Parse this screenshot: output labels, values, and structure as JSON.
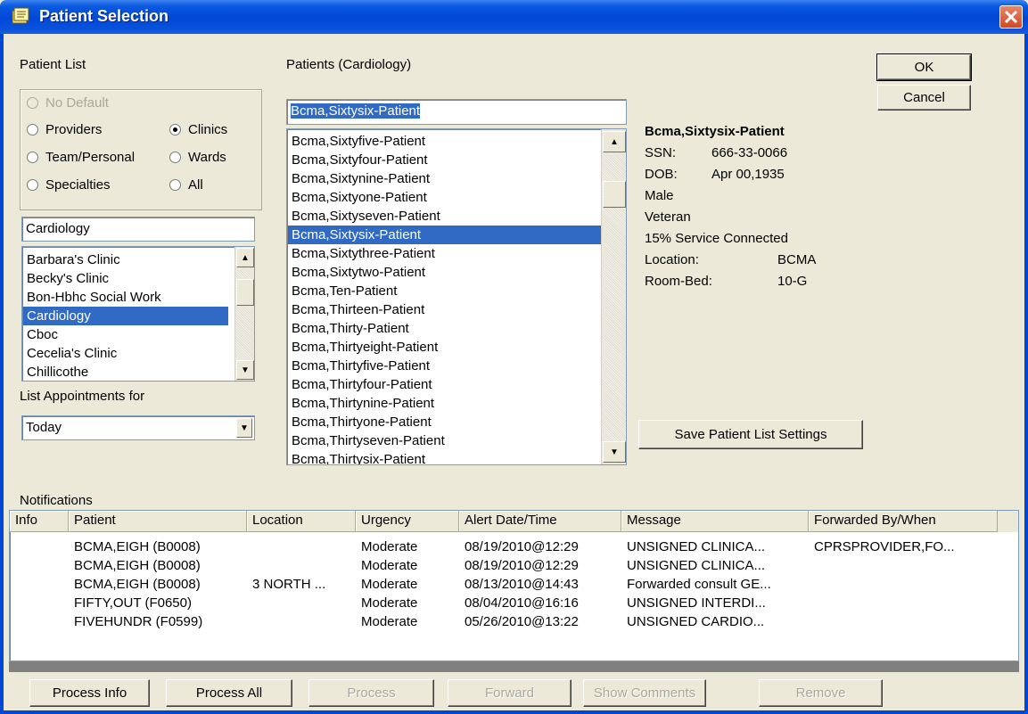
{
  "window": {
    "title": "Patient Selection",
    "close_symbol": "✕"
  },
  "patient_list": {
    "label": "Patient List",
    "radios": {
      "no_default": "No Default",
      "providers": "Providers",
      "team": "Team/Personal",
      "specialties": "Specialties",
      "clinics": "Clinics",
      "wards": "Wards",
      "all": "All"
    },
    "search_value": "Cardiology",
    "clinics": [
      "Barbara's Clinic",
      "Becky's Clinic",
      "Bon-Hbhc Social Work",
      "Cardiology",
      "Cboc",
      "Cecelia's Clinic",
      "Chillicothe"
    ],
    "list_appointments_label": "List Appointments for",
    "appointments_value": "Today"
  },
  "patients": {
    "label": "Patients (Cardiology)",
    "search_value": "Bcma,Sixtysix-Patient",
    "items": [
      "Bcma,Sixtyfive-Patient",
      "Bcma,Sixtyfour-Patient",
      "Bcma,Sixtynine-Patient",
      "Bcma,Sixtyone-Patient",
      "Bcma,Sixtyseven-Patient",
      "Bcma,Sixtysix-Patient",
      "Bcma,Sixtythree-Patient",
      "Bcma,Sixtytwo-Patient",
      "Bcma,Ten-Patient",
      "Bcma,Thirteen-Patient",
      "Bcma,Thirty-Patient",
      "Bcma,Thirtyeight-Patient",
      "Bcma,Thirtyfive-Patient",
      "Bcma,Thirtyfour-Patient",
      "Bcma,Thirtynine-Patient",
      "Bcma,Thirtyone-Patient",
      "Bcma,Thirtyseven-Patient",
      "Bcma,Thirtysix-Patient"
    ]
  },
  "patient_info": {
    "name": "Bcma,Sixtysix-Patient",
    "ssn_label": "SSN:",
    "ssn": "666-33-0066",
    "dob_label": "DOB:",
    "dob": "Apr 00,1935",
    "sex": "Male",
    "veteran": "Veteran",
    "service": "15% Service Connected",
    "location_label": "Location:",
    "location": "BCMA",
    "roombed_label": "Room-Bed:",
    "roombed": "10-G"
  },
  "buttons": {
    "ok": "OK",
    "cancel": "Cancel",
    "save_settings": "Save Patient List Settings",
    "process_info": "Process Info",
    "process_all": "Process All",
    "process": "Process",
    "forward": "Forward",
    "show_comments": "Show Comments",
    "remove": "Remove"
  },
  "notifications": {
    "label": "Notifications",
    "columns": [
      "Info",
      "Patient",
      "Location",
      "Urgency",
      "Alert Date/Time",
      "Message",
      "Forwarded By/When"
    ],
    "rows": [
      {
        "info": "",
        "patient": "BCMA,EIGH (B0008)",
        "location": "",
        "urgency": "Moderate",
        "datetime": "08/19/2010@12:29",
        "message": "UNSIGNED CLINICA...",
        "forwarded": "CPRSPROVIDER,FO..."
      },
      {
        "info": "",
        "patient": "BCMA,EIGH (B0008)",
        "location": "",
        "urgency": "Moderate",
        "datetime": "08/19/2010@12:29",
        "message": "UNSIGNED CLINICA...",
        "forwarded": ""
      },
      {
        "info": "",
        "patient": "BCMA,EIGH (B0008)",
        "location": "3 NORTH ...",
        "urgency": "Moderate",
        "datetime": "08/13/2010@14:43",
        "message": "Forwarded consult GE...",
        "forwarded": ""
      },
      {
        "info": "",
        "patient": "FIFTY,OUT (F0650)",
        "location": "",
        "urgency": "Moderate",
        "datetime": "08/04/2010@16:16",
        "message": "UNSIGNED INTERDI...",
        "forwarded": ""
      },
      {
        "info": "",
        "patient": "FIVEHUNDR (F0599)",
        "location": "",
        "urgency": "Moderate",
        "datetime": "05/26/2010@13:22",
        "message": "UNSIGNED CARDIO...",
        "forwarded": ""
      }
    ]
  }
}
